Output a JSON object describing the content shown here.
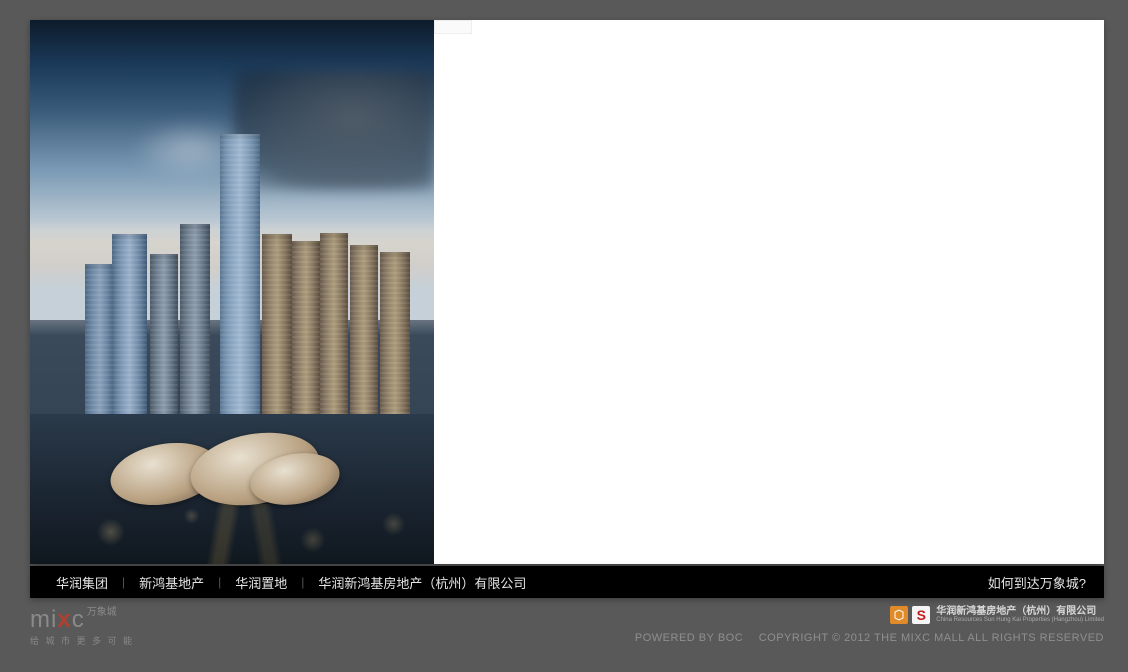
{
  "logo": {
    "brand_main": "mixc",
    "brand_cn": "万象城",
    "tagline": "给 城 市 更 多 可 能"
  },
  "nav": {
    "items": [
      {
        "label": "华润集团"
      },
      {
        "label": "新鸿基地产"
      },
      {
        "label": "华润置地"
      },
      {
        "label": "华润新鸿基房地产（杭州）有限公司"
      }
    ],
    "right_link": "如何到达万象城?"
  },
  "partner": {
    "company_cn": "华润新鸿基房地产（杭州）有限公司",
    "company_en": "China Resources Sun Hung Kai Properties (Hangzhou) Limited"
  },
  "footer": {
    "powered": "POWERED BY BOC",
    "copyright": "COPYRIGHT © 2012 THE MIXC MALL ALL RIGHTS RESERVED"
  }
}
